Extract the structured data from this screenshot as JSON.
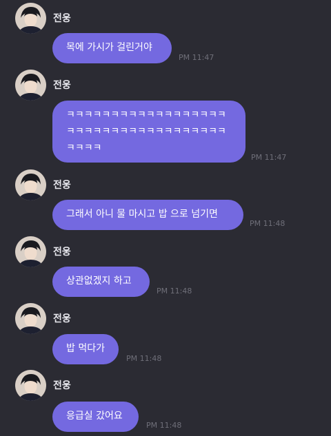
{
  "messages": [
    {
      "sender": "전웅",
      "text": "목에 가시가 걸린거야",
      "time": "PM 11:47"
    },
    {
      "sender": "전웅",
      "text": "ㅋㅋㅋㅋㅋㅋㅋㅋㅋㅋㅋㅋㅋㅋㅋㅋㅋㅋㅋㅋㅋㅋㅋㅋㅋㅋㅋㅋㅋㅋㅋㅋㅋㅋㅋㅋㅋㅋㅋㅋ",
      "time": "PM 11:47"
    },
    {
      "sender": "전웅",
      "text": "그래서 아니 물 마시고 밥 으로 넘기면",
      "time": "PM 11:48"
    },
    {
      "sender": "전웅",
      "text": "상관없겠지 하고",
      "time": "PM 11:48"
    },
    {
      "sender": "전웅",
      "text": "밥 먹다가",
      "time": "PM 11:48"
    },
    {
      "sender": "전웅",
      "text": "응급실 갔어요",
      "time": "PM 11:48"
    }
  ],
  "colors": {
    "background": "#2b2b33",
    "bubble": "#7469e0",
    "time": "#6f6f79",
    "sender": "#e8e8ee"
  }
}
